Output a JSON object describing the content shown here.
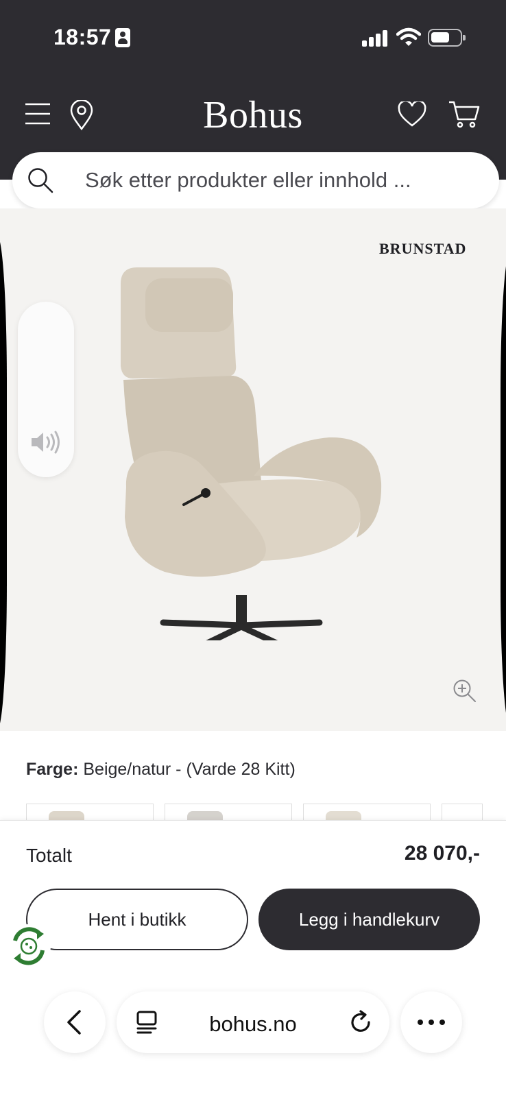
{
  "status_bar": {
    "time": "18:57"
  },
  "header": {
    "logo": "Bohus"
  },
  "search": {
    "placeholder": "Søk etter produkter eller innhold ..."
  },
  "product": {
    "brand": "BRUNSTAD",
    "color_label": "Farge:",
    "color_value": "Beige/natur - (Varde 28 Kitt)",
    "swatch_colors": [
      "#ddd6ca",
      "#d5d2cd",
      "#e3ddd2"
    ]
  },
  "cart": {
    "total_label": "Totalt",
    "total_value": "28 070,-",
    "pickup_button": "Hent i butikk",
    "add_button": "Legg i handlekurv"
  },
  "browser": {
    "url": "bohus.no"
  },
  "colors": {
    "header_bg": "#2d2c31",
    "image_bg": "#f4f3f1",
    "eco_green": "#2e7d32"
  }
}
